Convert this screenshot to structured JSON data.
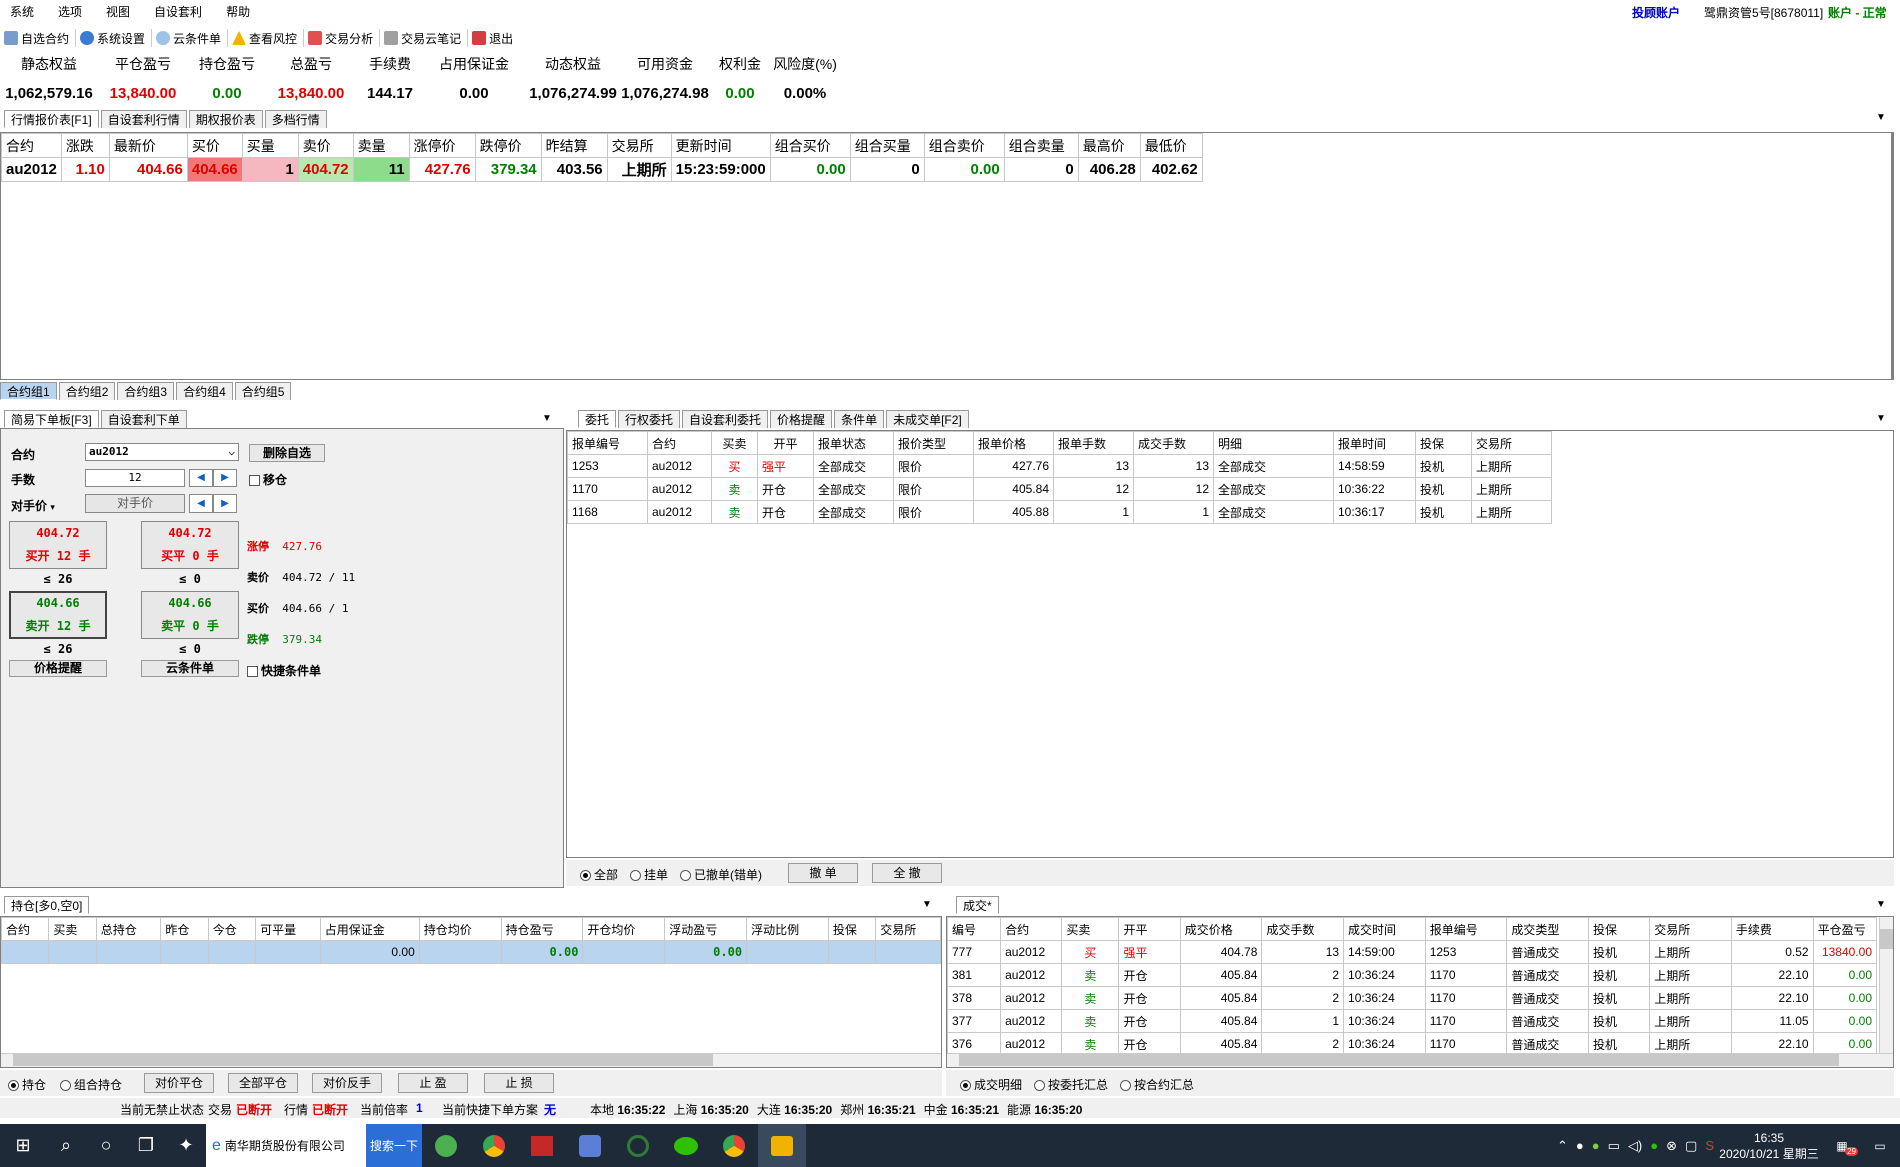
{
  "menu": [
    "系统",
    "选项",
    "视图",
    "自设套利",
    "帮助"
  ],
  "account": {
    "type": "投顾账户",
    "name": "鹭鼎资管5号[8678011]",
    "status": "账户 - 正常"
  },
  "toolbar": [
    "自选合约",
    "系统设置",
    "云条件单",
    "查看风控",
    "交易分析",
    "交易云笔记",
    "退出"
  ],
  "summary": [
    {
      "label": "静态权益",
      "value": "1,062,579.16",
      "color": "black"
    },
    {
      "label": "平仓盈亏",
      "value": "13,840.00",
      "color": "red"
    },
    {
      "label": "持仓盈亏",
      "value": "0.00",
      "color": "green"
    },
    {
      "label": "总盈亏",
      "value": "13,840.00",
      "color": "red"
    },
    {
      "label": "手续费",
      "value": "144.17",
      "color": "black"
    },
    {
      "label": "占用保证金",
      "value": "0.00",
      "color": "black"
    },
    {
      "label": "动态权益",
      "value": "1,076,274.99",
      "color": "black"
    },
    {
      "label": "可用资金",
      "value": "1,076,274.98",
      "color": "black"
    },
    {
      "label": "权利金",
      "value": "0.00",
      "color": "green"
    },
    {
      "label": "风险度(%)",
      "value": "0.00%",
      "color": "black"
    }
  ],
  "quote_tabs": [
    "行情报价表[F1]",
    "自设套利行情",
    "期权报价表",
    "多档行情"
  ],
  "quote": {
    "headers": [
      "合约",
      "涨跌",
      "最新价",
      "买价",
      "买量",
      "卖价",
      "卖量",
      "涨停价",
      "跌停价",
      "昨结算",
      "交易所",
      "更新时间",
      "组合买价",
      "组合买量",
      "组合卖价",
      "组合卖量",
      "最高价",
      "最低价"
    ],
    "row": [
      "au2012",
      "1.10",
      "404.66",
      "404.66",
      "1",
      "404.72",
      "11",
      "427.76",
      "379.34",
      "403.56",
      "上期所",
      "15:23:59:000",
      "0.00",
      "0",
      "0.00",
      "0",
      "406.28",
      "402.62"
    ]
  },
  "group_tabs": [
    "合约组1",
    "合约组2",
    "合约组3",
    "合约组4",
    "合约组5"
  ],
  "order_tabs": [
    "简易下单板[F3]",
    "自设套利下单"
  ],
  "order": {
    "contract_label": "合约",
    "contract": "au2012",
    "delete_btn": "删除自选",
    "qty_label": "手数",
    "qty": "12",
    "move_label": "移仓",
    "price_label": "对手价",
    "price_field": "对手价",
    "buy_open": {
      "price": "404.72",
      "label": "买开  12 手",
      "limit": "≤ 26"
    },
    "buy_close": {
      "price": "404.72",
      "label": "买平  0 手",
      "limit": "≤ 0"
    },
    "sell_open": {
      "price": "404.66",
      "label": "卖开  12 手",
      "limit": "≤ 26"
    },
    "sell_close": {
      "price": "404.66",
      "label": "卖平  0 手",
      "limit": "≤ 0"
    },
    "info": [
      {
        "k": "涨停",
        "v": "427.76"
      },
      {
        "k": "卖价",
        "v": "404.72 / 11"
      },
      {
        "k": "买价",
        "v": "404.66 / 1"
      },
      {
        "k": "跌停",
        "v": "379.34"
      }
    ],
    "price_alert": "价格提醒",
    "cloud_cond": "云条件单",
    "quick_cond": "快捷条件单"
  },
  "entrust_tabs": [
    "委托",
    "行权委托",
    "自设套利委托",
    "价格提醒",
    "条件单",
    "未成交单[F2]"
  ],
  "entrust": {
    "headers": [
      "报单编号",
      "合约",
      "买卖",
      "开平",
      "报单状态",
      "报价类型",
      "报单价格",
      "报单手数",
      "成交手数",
      "明细",
      "报单时间",
      "投保",
      "交易所"
    ],
    "rows": [
      [
        "1253",
        "au2012",
        "买",
        "强平",
        "全部成交",
        "限价",
        "427.76",
        "13",
        "13",
        "全部成交",
        "14:58:59",
        "投机",
        "上期所"
      ],
      [
        "1170",
        "au2012",
        "卖",
        "开仓",
        "全部成交",
        "限价",
        "405.84",
        "12",
        "12",
        "全部成交",
        "10:36:22",
        "投机",
        "上期所"
      ],
      [
        "1168",
        "au2012",
        "卖",
        "开仓",
        "全部成交",
        "限价",
        "405.88",
        "1",
        "1",
        "全部成交",
        "10:36:17",
        "投机",
        "上期所"
      ]
    ],
    "filters": [
      "全部",
      "挂单",
      "已撤单(错单)"
    ],
    "cancel": "撤 单",
    "cancel_all": "全 撤"
  },
  "position_tab": "持仓[多0,空0]",
  "position": {
    "headers": [
      "合约",
      "买卖",
      "总持仓",
      "昨仓",
      "今仓",
      "可平量",
      "占用保证金",
      "持仓均价",
      "持仓盈亏",
      "开仓均价",
      "浮动盈亏",
      "浮动比例",
      "投保",
      "交易所"
    ],
    "totals": {
      "margin": "0.00",
      "pnl": "0.00",
      "float": "0.00"
    },
    "radios": [
      "持仓",
      "组合持仓"
    ],
    "buttons": [
      "对价平仓",
      "全部平仓",
      "对价反手",
      "止 盈",
      "止 损"
    ]
  },
  "trade_tab": "成交*",
  "trade": {
    "headers": [
      "编号",
      "合约",
      "买卖",
      "开平",
      "成交价格",
      "成交手数",
      "成交时间",
      "报单编号",
      "成交类型",
      "投保",
      "交易所",
      "手续费",
      "平仓盈亏"
    ],
    "rows": [
      [
        "777",
        "au2012",
        "买",
        "强平",
        "404.78",
        "13",
        "14:59:00",
        "1253",
        "普通成交",
        "投机",
        "上期所",
        "0.52",
        "13840.00"
      ],
      [
        "381",
        "au2012",
        "卖",
        "开仓",
        "405.84",
        "2",
        "10:36:24",
        "1170",
        "普通成交",
        "投机",
        "上期所",
        "22.10",
        "0.00"
      ],
      [
        "378",
        "au2012",
        "卖",
        "开仓",
        "405.84",
        "2",
        "10:36:24",
        "1170",
        "普通成交",
        "投机",
        "上期所",
        "22.10",
        "0.00"
      ],
      [
        "377",
        "au2012",
        "卖",
        "开仓",
        "405.84",
        "1",
        "10:36:24",
        "1170",
        "普通成交",
        "投机",
        "上期所",
        "11.05",
        "0.00"
      ],
      [
        "376",
        "au2012",
        "卖",
        "开仓",
        "405.84",
        "2",
        "10:36:24",
        "1170",
        "普通成交",
        "投机",
        "上期所",
        "22.10",
        "0.00"
      ]
    ],
    "radios": [
      "成交明细",
      "按委托汇总",
      "按合约汇总"
    ]
  },
  "status": {
    "text1": "当前无禁止状态",
    "trade_lbl": "交易",
    "trade_val": "已断开",
    "quote_lbl": "行情",
    "quote_val": "已断开",
    "mult_lbl": "当前倍率",
    "mult_val": "1",
    "plan_lbl": "当前快捷下单方案",
    "plan_val": "无",
    "times": [
      {
        "k": "本地",
        "v": "16:35:22"
      },
      {
        "k": "上海",
        "v": "16:35:20"
      },
      {
        "k": "大连",
        "v": "16:35:20"
      },
      {
        "k": "郑州",
        "v": "16:35:21"
      },
      {
        "k": "中金",
        "v": "16:35:21"
      },
      {
        "k": "能源",
        "v": "16:35:20"
      }
    ]
  },
  "taskbar": {
    "app": "南华期货股份有限公司",
    "search": "搜索一下",
    "time": "16:35",
    "date": "2020/10/21 星期三",
    "badge": "29"
  }
}
